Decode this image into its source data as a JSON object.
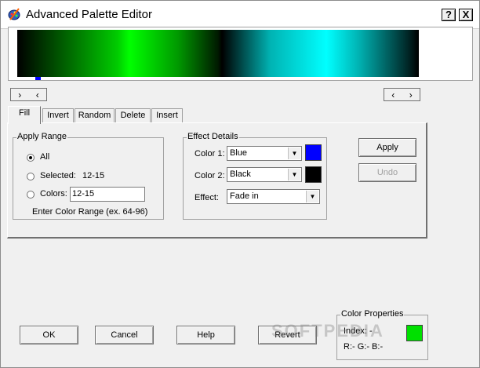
{
  "window": {
    "title": "Advanced Palette Editor",
    "help_label": "?",
    "close_label": "X"
  },
  "palette_nav": {
    "left_group": [
      "›",
      "‹"
    ],
    "right_group": [
      "‹",
      "›"
    ]
  },
  "tabs": [
    {
      "label": "Fill",
      "active": true
    },
    {
      "label": "Invert",
      "active": false
    },
    {
      "label": "Random",
      "active": false
    },
    {
      "label": "Delete",
      "active": false
    },
    {
      "label": "Insert",
      "active": false
    }
  ],
  "apply_range": {
    "title": "Apply Range",
    "options": [
      {
        "label": "All",
        "checked": true
      },
      {
        "label": "Selected:",
        "value": "12-15",
        "checked": false
      },
      {
        "label": "Colors:",
        "checked": false
      }
    ],
    "colors_input_value": "12-15",
    "hint": "Enter Color Range (ex. 64-96)"
  },
  "effect_details": {
    "title": "Effect Details",
    "color1": {
      "label": "Color 1:",
      "value": "Blue",
      "swatch": "#0000ff"
    },
    "color2": {
      "label": "Color 2:",
      "value": "Black",
      "swatch": "#000000"
    },
    "effect": {
      "label": "Effect:",
      "value": "Fade in"
    }
  },
  "side_buttons": {
    "apply": "Apply",
    "undo": "Undo"
  },
  "bottom_buttons": {
    "ok": "OK",
    "cancel": "Cancel",
    "help": "Help",
    "revert": "Revert"
  },
  "color_properties": {
    "title": "Color Properties",
    "index": "Index: -",
    "rgb": "R:-  G:-  B:-",
    "swatch": "#00e000"
  },
  "watermark": "SOFTPEDIA"
}
